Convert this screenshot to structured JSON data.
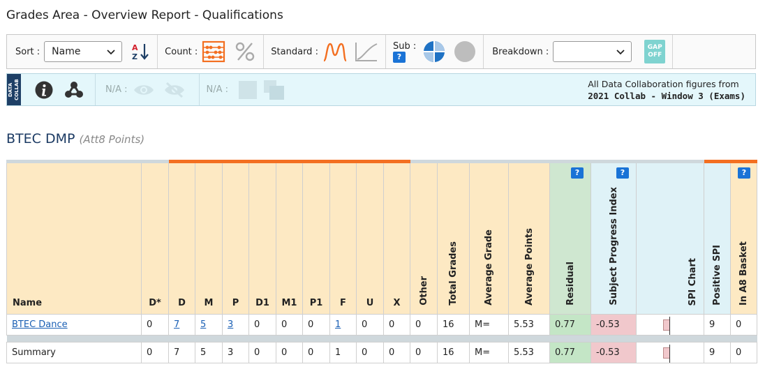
{
  "page": {
    "title": "Grades Area - Overview Report - Qualifications"
  },
  "toolbar": {
    "sort_label": "Sort :",
    "sort_value": "Name",
    "count_label": "Count :",
    "standard_label": "Standard :",
    "sub_label": "Sub :",
    "help_text": "?",
    "breakdown_label": "Breakdown :",
    "breakdown_value": "",
    "gap_top": "GAP",
    "gap_bottom": "OFF"
  },
  "collab": {
    "tag_text": "DATA COLLAB",
    "na_label_1": "N/A :",
    "na_label_2": "N/A :",
    "info_line1": "All Data Collaboration figures from",
    "info_line2": "2021 Collab - Window 3 (Exams)"
  },
  "section": {
    "title": "BTEC DMP",
    "subtitle": "(Att8 Points)"
  },
  "table": {
    "headers": {
      "name": "Name",
      "dstar": "D*",
      "d": "D",
      "m": "M",
      "p": "P",
      "d1": "D1",
      "m1": "M1",
      "p1": "P1",
      "f": "F",
      "u": "U",
      "x": "X",
      "other": "Other",
      "total": "Total Grades",
      "avg_grade": "Average Grade",
      "avg_points": "Average Points",
      "residual": "Residual",
      "spi": "Subject Progress Index",
      "spi_chart": "SPI Chart",
      "pos_spi": "Positive SPI",
      "a8": "In A8 Basket",
      "help": "?"
    },
    "rows": [
      {
        "name": "BTEC Dance",
        "dstar": "0",
        "d": "7",
        "m": "5",
        "p": "3",
        "d1": "0",
        "m1": "0",
        "p1": "0",
        "f": "1",
        "u": "0",
        "x": "0",
        "other": "0",
        "total": "16",
        "avg_grade": "M=",
        "avg_points": "5.53",
        "residual": "0.77",
        "spi": "-0.53",
        "pos_spi": "9",
        "a8": "0"
      }
    ],
    "summary": {
      "name": "Summary",
      "dstar": "0",
      "d": "7",
      "m": "5",
      "p": "3",
      "d1": "0",
      "m1": "0",
      "p1": "0",
      "f": "1",
      "u": "0",
      "x": "0",
      "other": "0",
      "total": "16",
      "avg_grade": "M=",
      "avg_points": "5.53",
      "residual": "0.77",
      "spi": "-0.53",
      "pos_spi": "9",
      "a8": "0"
    }
  },
  "colors": {
    "accent_orange": "#f36f21",
    "navy": "#1e3f66",
    "help_blue": "#1a73d6",
    "header_bg": "#fde9c3",
    "gap_teal": "#7fd3d0"
  }
}
